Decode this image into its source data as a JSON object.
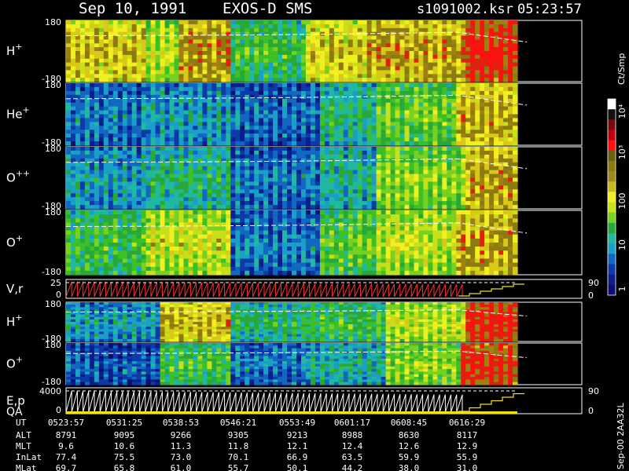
{
  "header": {
    "date": "Sep 10, 1991",
    "mission": "EXOS-D SMS",
    "file": "s1091002.ksr",
    "time": "05:23:57"
  },
  "colorbar": {
    "unit_label": "Ct/Smp",
    "tick_labels": [
      "1",
      "10",
      "100",
      "10³",
      "10⁴"
    ]
  },
  "side_stamp": "Sep-00 2AA32L",
  "panels": [
    {
      "label": "H",
      "sup": "+",
      "top_tick": "180",
      "bottom_tick": "-180",
      "type": "spec",
      "profile": "h1"
    },
    {
      "label": "He",
      "sup": "+",
      "top_tick": "180",
      "bottom_tick": "-180",
      "type": "spec",
      "profile": "he"
    },
    {
      "label": "O",
      "sup": "++",
      "top_tick": "180",
      "bottom_tick": "-180",
      "type": "spec",
      "profile": "opp"
    },
    {
      "label": "O",
      "sup": "+",
      "top_tick": "180",
      "bottom_tick": "-180",
      "type": "spec",
      "profile": "op"
    },
    {
      "label": "V,r",
      "sup": "",
      "top_tick": "25",
      "bottom_tick": "0",
      "right_top": "90",
      "right_bottom": "0",
      "type": "line",
      "color": "#ff3030"
    },
    {
      "label": "H",
      "sup": "+",
      "top_tick": "180",
      "bottom_tick": "-180",
      "type": "spec",
      "profile": "h2"
    },
    {
      "label": "O",
      "sup": "+",
      "top_tick": "180",
      "bottom_tick": "-180",
      "type": "spec",
      "profile": "o2"
    },
    {
      "label": "E,p",
      "label2": "QA",
      "sup": "",
      "top_tick": "4000",
      "bottom_tick": "0",
      "right_top": "90",
      "right_bottom": "0",
      "type": "line",
      "color": "#ffffff"
    }
  ],
  "ephemeris": {
    "row_labels": [
      "UT",
      "ALT",
      "MLT",
      "InLat",
      "MLat"
    ],
    "columns": [
      [
        "0523:57",
        "8791",
        "9.6",
        "77.4",
        "69.7"
      ],
      [
        "0531:25",
        "9095",
        "10.6",
        "75.5",
        "65.8"
      ],
      [
        "0538:53",
        "9266",
        "11.3",
        "73.0",
        "61.0"
      ],
      [
        "0546:21",
        "9305",
        "11.8",
        "70.1",
        "55.7"
      ],
      [
        "0553:49",
        "9213",
        "12.1",
        "66.9",
        "50.1"
      ],
      [
        "0601:17",
        "8988",
        "12.4",
        "63.5",
        "44.2"
      ],
      [
        "0608:45",
        "8630",
        "12.6",
        "59.9",
        "38.0"
      ],
      [
        "0616:29",
        "8117",
        "12.9",
        "55.9",
        "31.0"
      ]
    ]
  },
  "chart_data": {
    "type": "heatmap",
    "title": "Sep 10, 1991   EXOS-D SMS",
    "x_ticks_ut": [
      "0523:57",
      "0531:25",
      "0538:53",
      "0546:21",
      "0553:49",
      "0601:17",
      "0608:45",
      "0616:29"
    ],
    "series": [
      {
        "name": "H+",
        "ylim": [
          -180,
          180
        ]
      },
      {
        "name": "He+",
        "ylim": [
          -180,
          180
        ]
      },
      {
        "name": "O++",
        "ylim": [
          -180,
          180
        ]
      },
      {
        "name": "O+",
        "ylim": [
          -180,
          180
        ]
      },
      {
        "name": "V,r",
        "ylim": [
          0,
          25
        ],
        "right_ylim": [
          0,
          90
        ]
      },
      {
        "name": "H+",
        "ylim": [
          -180,
          180
        ]
      },
      {
        "name": "O+",
        "ylim": [
          -180,
          180
        ]
      },
      {
        "name": "E,p",
        "ylim": [
          0,
          4000
        ],
        "right_ylim": [
          0,
          90
        ]
      }
    ],
    "colorbar_scale": "log",
    "colorbar_range": [
      1,
      10000
    ],
    "colors": {
      "low": "#0a1f7a",
      "mid_low": "#1ab3c8",
      "mid": "#38c040",
      "mid_high": "#e8e820",
      "high_olive": "#8a7a10",
      "saturated": "#ff1010",
      "max": "#ffffff"
    }
  }
}
